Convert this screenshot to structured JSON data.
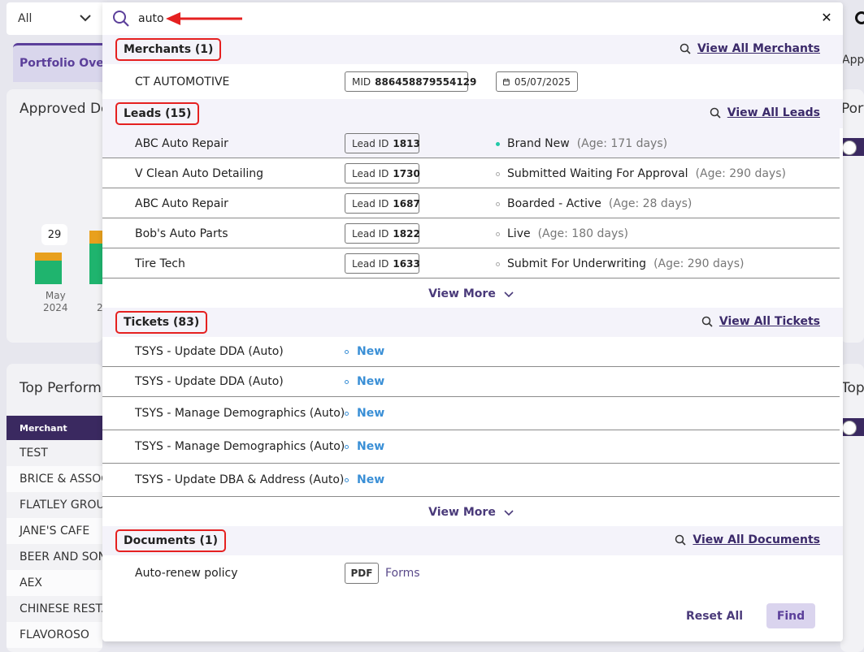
{
  "filter": {
    "selected": "All"
  },
  "search": {
    "value": "auto"
  },
  "background": {
    "tab_active": "Portfolio Overview",
    "tab_right": "Approved V",
    "card1_title": "Approved Deals",
    "chart_data": {
      "type": "bar",
      "categories": [
        "May 2024"
      ],
      "data_labels": [
        "29"
      ],
      "axis_labels": [
        "May",
        "2024",
        "2"
      ]
    },
    "card2_title": "Top Performing Merchants",
    "table_header": "Merchant",
    "merchants": [
      "TEST",
      "BRICE & ASSOCIATES",
      "FLATLEY GROUP",
      "JANE'S CAFE",
      "BEER AND SONS",
      "AEX",
      "CHINESE RESTAURANT",
      "FLAVOROSO"
    ],
    "right_title_1": "Portfolio",
    "right_title_2": "Top"
  },
  "sections": {
    "merchants": {
      "label": "Merchants (1)",
      "link": "View All Merchants",
      "items": [
        {
          "name": "CT AUTOMOTIVE",
          "mid_label": "MID",
          "mid": "886458879554129",
          "date": "05/07/2025"
        }
      ]
    },
    "leads": {
      "label": "Leads (15)",
      "link": "View All Leads",
      "id_label": "Lead ID",
      "items": [
        {
          "name": "ABC Auto Repair",
          "id": "1813",
          "status": "Brand New",
          "age": "(Age: 171 days)"
        },
        {
          "name": "V Clean Auto Detailing",
          "id": "1730",
          "status": "Submitted Waiting For Approval",
          "age": "(Age: 290 days)"
        },
        {
          "name": "ABC Auto Repair",
          "id": "1687",
          "status": "Boarded - Active",
          "age": "(Age: 28 days)"
        },
        {
          "name": "Bob's Auto Parts",
          "id": "1822",
          "status": "Live",
          "age": "(Age: 180 days)"
        },
        {
          "name": "Tire Tech",
          "id": "1633",
          "status": "Submit For Underwriting",
          "age": "(Age: 290 days)"
        }
      ],
      "more": "View More"
    },
    "tickets": {
      "label": "Tickets (83)",
      "link": "View All Tickets",
      "items": [
        {
          "name": "TSYS - Update DDA (Auto)",
          "status": "New"
        },
        {
          "name": "TSYS - Update DDA (Auto)",
          "status": "New"
        },
        {
          "name": "TSYS - Manage Demographics (Auto)",
          "status": "New"
        },
        {
          "name": "TSYS - Manage Demographics (Auto)",
          "status": "New"
        },
        {
          "name": "TSYS - Update DBA & Address (Auto)",
          "status": "New"
        }
      ],
      "more": "View More"
    },
    "documents": {
      "label": "Documents (1)",
      "link": "View All Documents",
      "items": [
        {
          "name": "Auto-renew policy",
          "type": "PDF",
          "category": "Forms"
        }
      ]
    }
  },
  "buttons": {
    "reset": "Reset All",
    "find": "Find"
  },
  "colors": {
    "accent": "#5b3f9a",
    "annotation": "#e52020",
    "status_new": "#3a8fd6",
    "status_dot_active": "#22c9a8"
  }
}
